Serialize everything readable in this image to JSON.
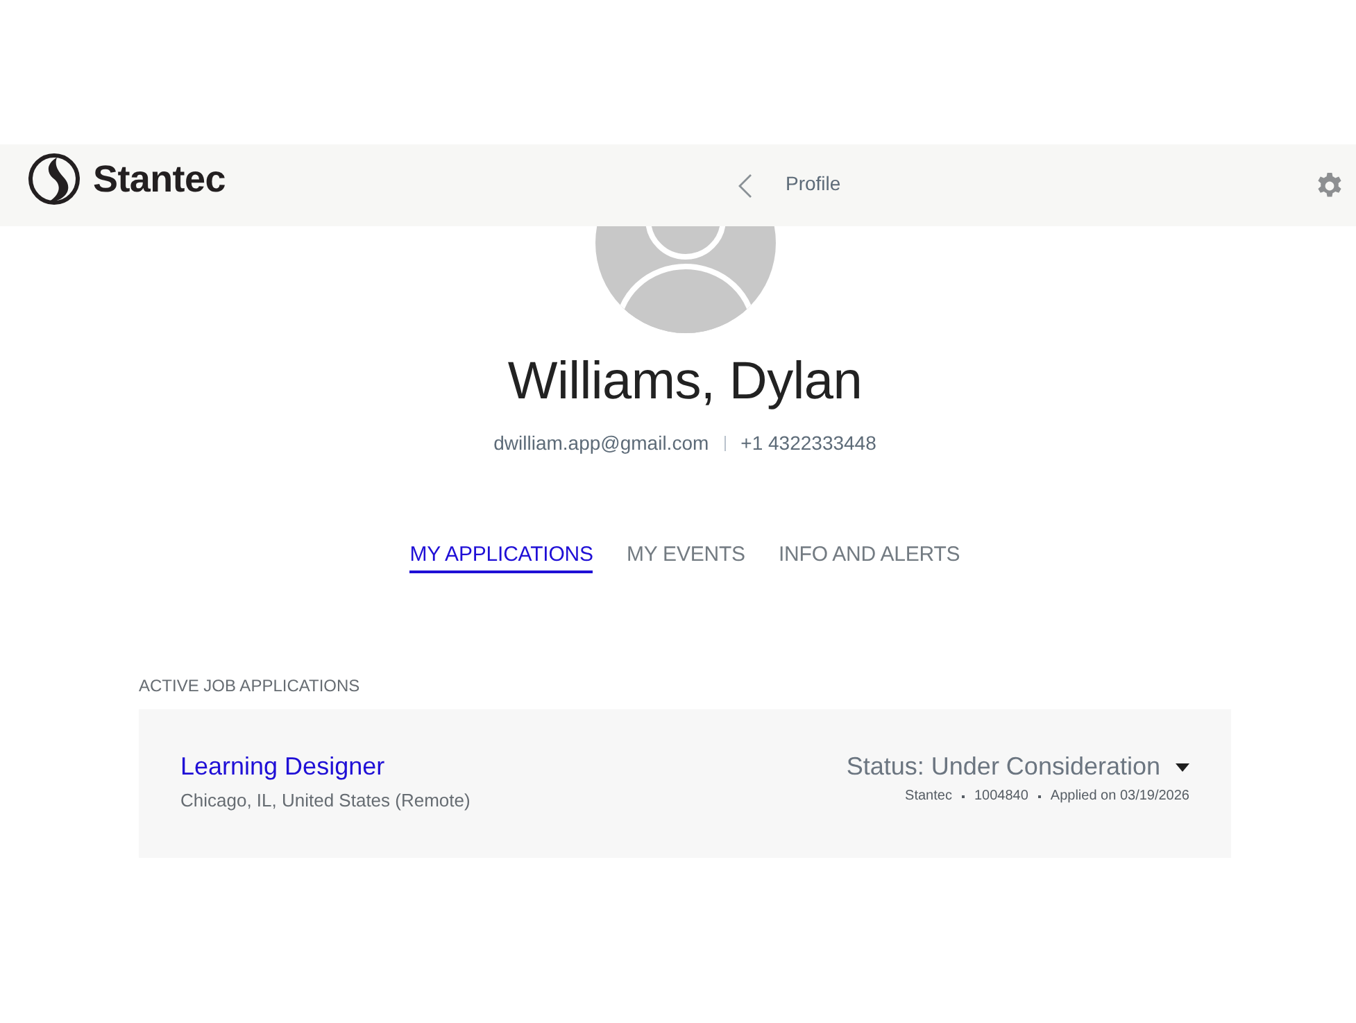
{
  "header": {
    "brand": "Stantec",
    "title": "Profile"
  },
  "profile": {
    "name": "Williams, Dylan",
    "email": "dwilliam.app@gmail.com",
    "phone": "+1 4322333448"
  },
  "tabs": [
    {
      "label": "MY APPLICATIONS",
      "selected": true
    },
    {
      "label": "MY EVENTS",
      "selected": false
    },
    {
      "label": "INFO AND ALERTS",
      "selected": false
    }
  ],
  "applications": {
    "heading": "ACTIVE JOB APPLICATIONS",
    "items": [
      {
        "title": "Learning Designer",
        "location": "Chicago, IL, United States (Remote)",
        "status": "Status: Under Consideration",
        "meta": [
          "Stantec",
          "1004840",
          "Applied on 03/19/2026"
        ]
      }
    ]
  }
}
